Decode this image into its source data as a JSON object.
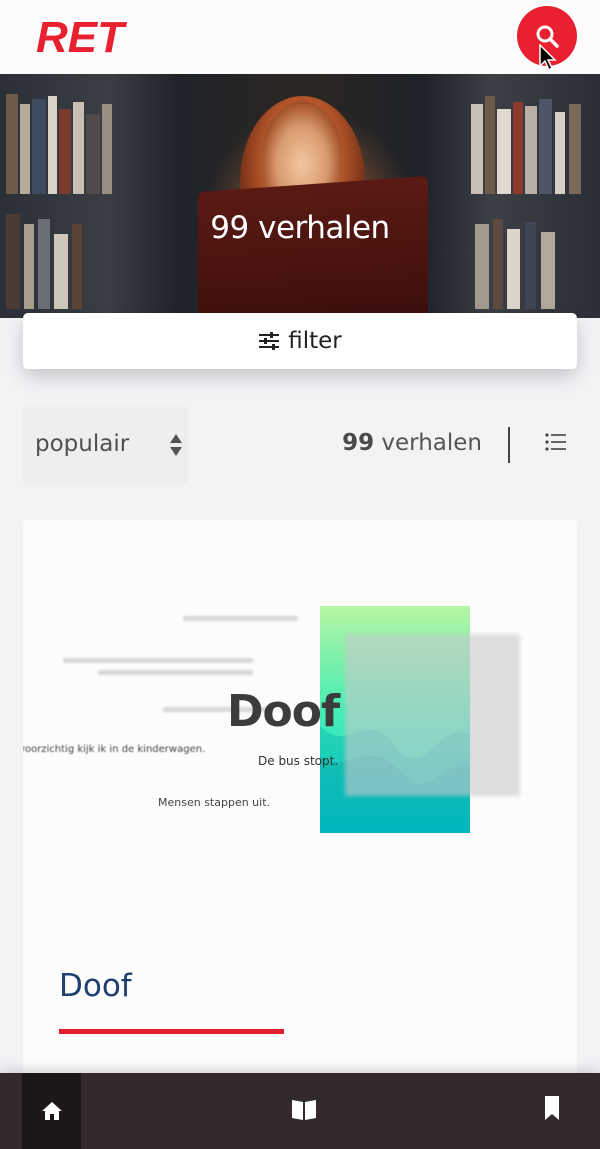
{
  "brand": {
    "logo_text": "RET",
    "accent": "#e8202f",
    "nav_bg": "#332a2c",
    "title_color": "#1f3f6e"
  },
  "header": {
    "search_icon": "search-icon"
  },
  "hero": {
    "title": "99 verhalen"
  },
  "filter": {
    "label": "filter",
    "icon": "sliders-icon"
  },
  "sort": {
    "selected": "populair",
    "icon": "sort-arrows-icon"
  },
  "results": {
    "count": "99",
    "unit": "verhalen",
    "view_icon": "list-icon"
  },
  "card": {
    "thumb_title": "Doof",
    "thumb_subtitle": "De bus stopt.",
    "thumb_line1": "voorzichtig kijk ik in de kinderwagen.",
    "thumb_line2": "Mensen stappen uit.",
    "title": "Doof"
  },
  "bottom_nav": {
    "items": [
      "home-icon",
      "book-icon",
      "bookmark-icon"
    ]
  }
}
